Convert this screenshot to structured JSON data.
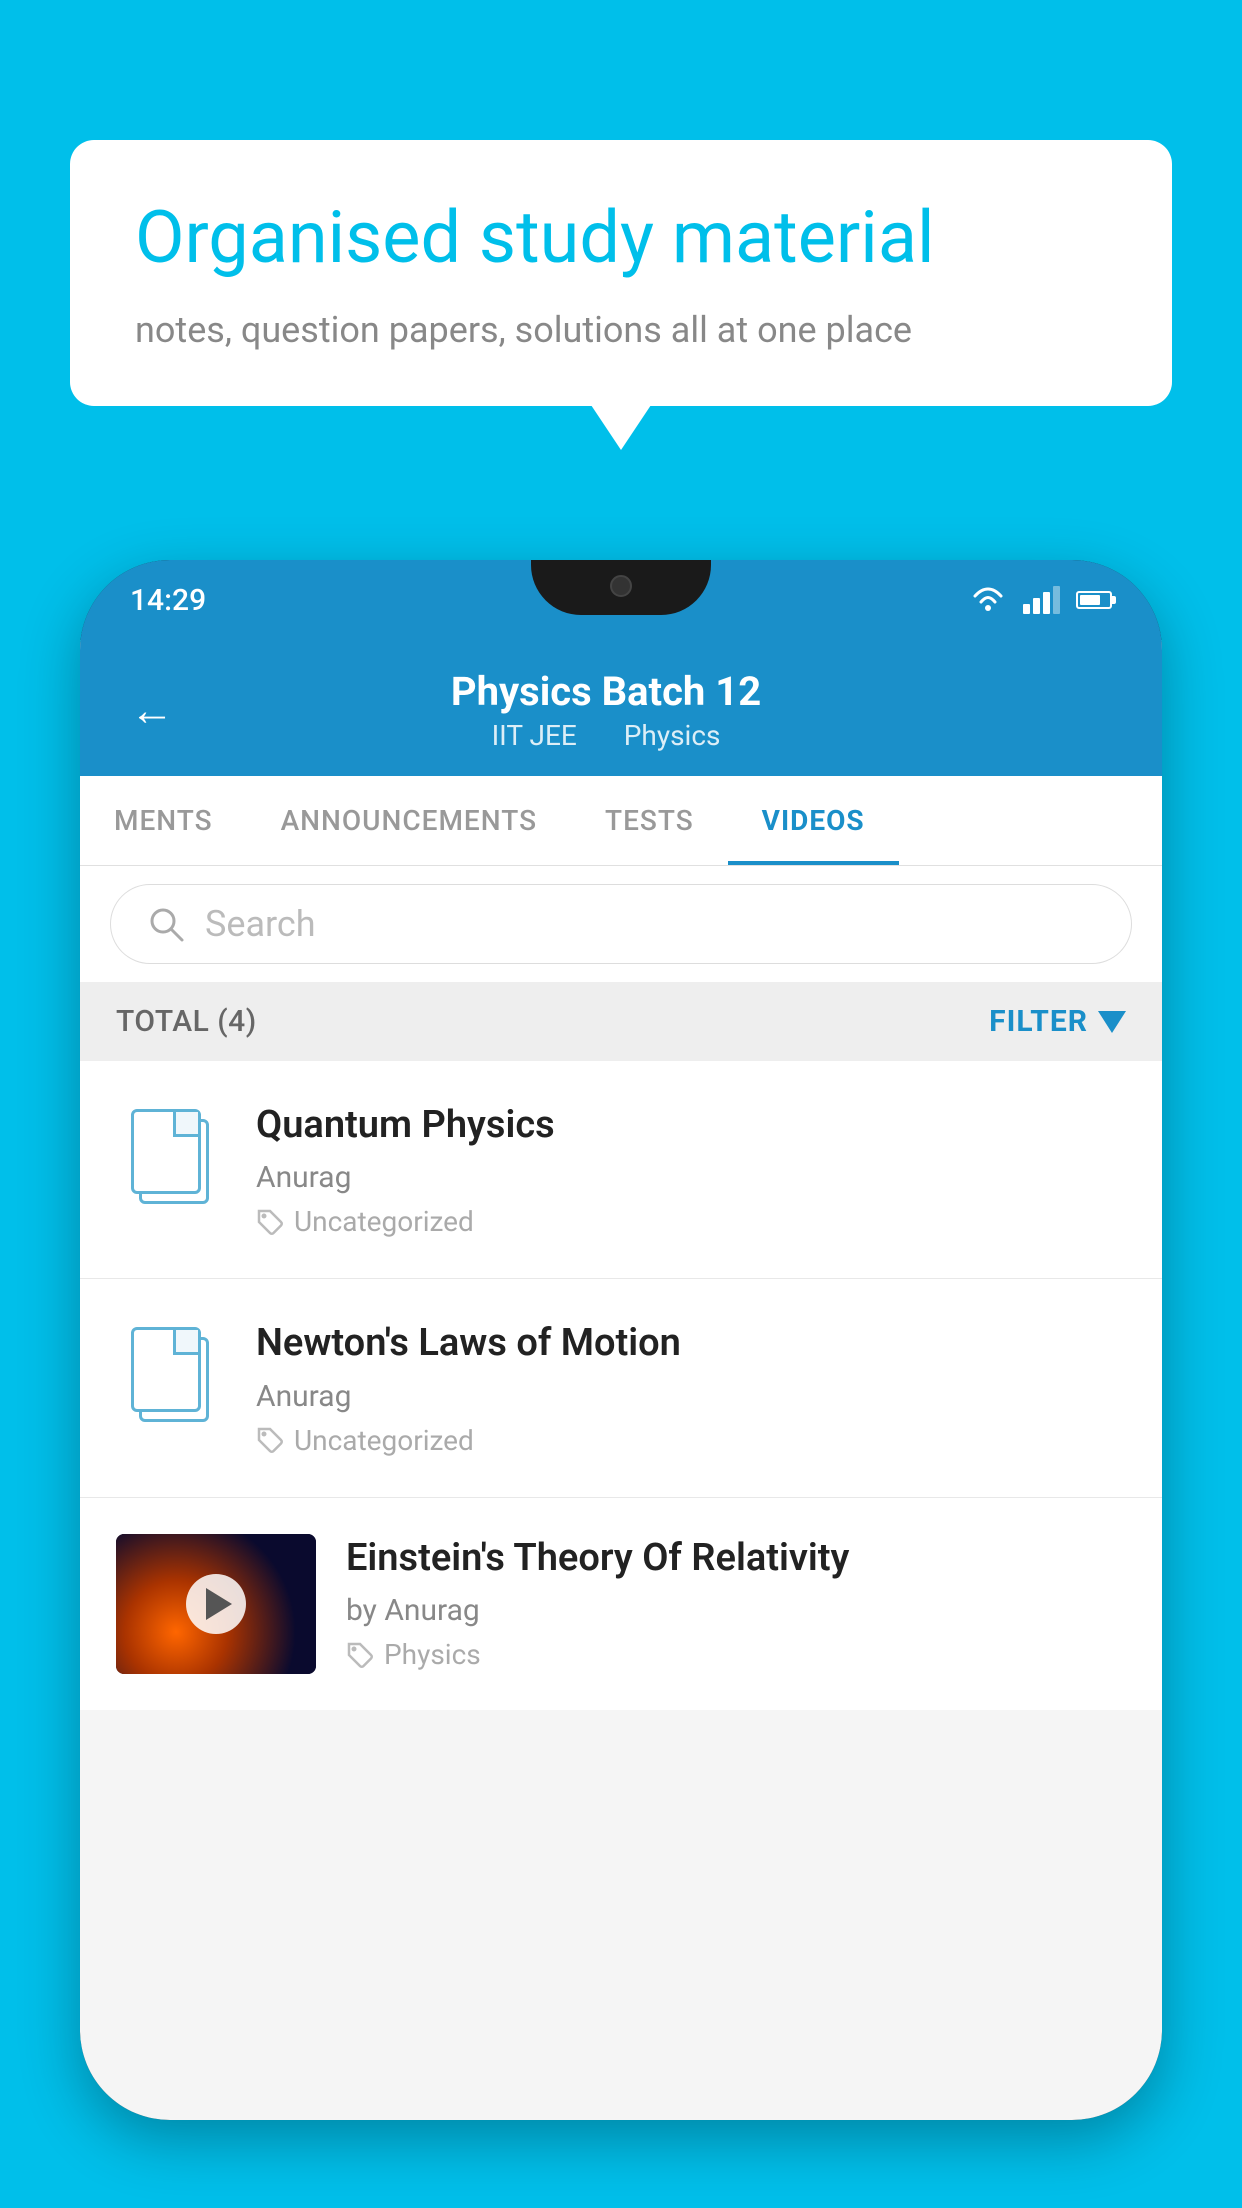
{
  "background_color": "#00BFEA",
  "speech_bubble": {
    "title": "Organised study material",
    "subtitle": "notes, question papers, solutions all at one place"
  },
  "phone": {
    "status_bar": {
      "time": "14:29"
    },
    "app_header": {
      "title": "Physics Batch 12",
      "tag1": "IIT JEE",
      "tag2": "Physics",
      "back_label": "←"
    },
    "tabs": [
      {
        "label": "MENTS",
        "active": false
      },
      {
        "label": "ANNOUNCEMENTS",
        "active": false
      },
      {
        "label": "TESTS",
        "active": false
      },
      {
        "label": "VIDEOS",
        "active": true
      }
    ],
    "search": {
      "placeholder": "Search"
    },
    "filter_bar": {
      "total_label": "TOTAL (4)",
      "filter_label": "FILTER"
    },
    "videos": [
      {
        "title": "Quantum Physics",
        "author": "Anurag",
        "tag": "Uncategorized",
        "has_thumbnail": false
      },
      {
        "title": "Newton's Laws of Motion",
        "author": "Anurag",
        "tag": "Uncategorized",
        "has_thumbnail": false
      },
      {
        "title": "Einstein's Theory Of Relativity",
        "author": "by Anurag",
        "tag": "Physics",
        "has_thumbnail": true
      }
    ]
  }
}
